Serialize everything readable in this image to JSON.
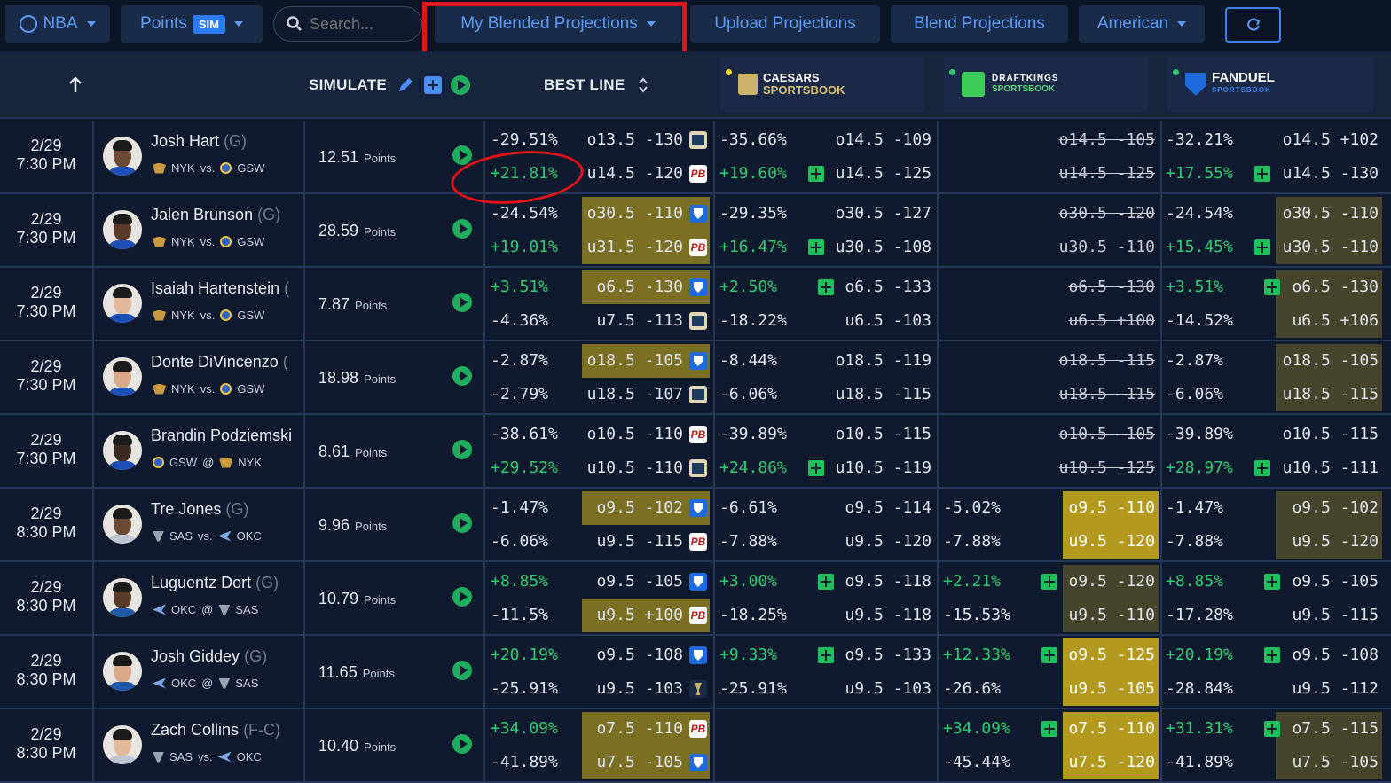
{
  "toolbar": {
    "league": "NBA",
    "market": "Points",
    "sim_badge": "SIM",
    "search_placeholder": "Search...",
    "projections": "My Blended Projections",
    "upload": "Upload Projections",
    "blend": "Blend Projections",
    "odds_format": "American"
  },
  "header": {
    "simulate": "SIMULATE",
    "best_line": "BEST LINE",
    "books": [
      {
        "name": "CAESARS",
        "sub": "SPORTSBOOK",
        "dot_color": "#f2d33a"
      },
      {
        "name": "DRAFTKINGS",
        "sub": "SPORTSBOOK",
        "dot_color": "#2ecc71"
      },
      {
        "name": "FANDUEL",
        "sub": "SPORTSBOOK",
        "dot_color": "#2ecc71"
      }
    ]
  },
  "rows": [
    {
      "date": "2/29",
      "time": "7:30 PM",
      "name": "Josh Hart",
      "pos": "(G)",
      "t1": "NYK",
      "sep": "vs.",
      "t2": "GSW",
      "sim": "12.51",
      "unit": "Points",
      "best": {
        "p1": "-29.51%",
        "l1": "o13.5 -130",
        "p2": "+21.81%",
        "l2": "u14.5 -120"
      },
      "cz": {
        "p1": "-35.66%",
        "l1": "o14.5 -109",
        "p2": "+19.60%",
        "l2": "u14.5 -125"
      },
      "dk": {
        "p1": "",
        "l1": "o14.5 -105",
        "p2": "",
        "l2": "u14.5 -125"
      },
      "fd": {
        "p1": "-32.21%",
        "l1": "o14.5 +102",
        "p2": "+17.55%",
        "l2": "u14.5 -130"
      }
    },
    {
      "date": "2/29",
      "time": "7:30 PM",
      "name": "Jalen Brunson",
      "pos": "(G)",
      "t1": "NYK",
      "sep": "vs.",
      "t2": "GSW",
      "sim": "28.59",
      "unit": "Points",
      "best": {
        "p1": "-24.54%",
        "l1": "o30.5 -110",
        "p2": "+19.01%",
        "l2": "u31.5 -120"
      },
      "cz": {
        "p1": "-29.35%",
        "l1": "o30.5 -127",
        "p2": "+16.47%",
        "l2": "u30.5 -108"
      },
      "dk": {
        "p1": "",
        "l1": "o30.5 -120",
        "p2": "",
        "l2": "u30.5 -110"
      },
      "fd": {
        "p1": "-24.54%",
        "l1": "o30.5 -110",
        "p2": "+15.45%",
        "l2": "u30.5 -110"
      }
    },
    {
      "date": "2/29",
      "time": "7:30 PM",
      "name": "Isaiah Hartenstein",
      "pos": "(",
      "t1": "NYK",
      "sep": "vs.",
      "t2": "GSW",
      "sim": "7.87",
      "unit": "Points",
      "best": {
        "p1": "+3.51%",
        "l1": "o6.5 -130",
        "p2": "-4.36%",
        "l2": "u7.5 -113"
      },
      "cz": {
        "p1": "+2.50%",
        "l1": "o6.5 -133",
        "p2": "-18.22%",
        "l2": "u6.5 -103"
      },
      "dk": {
        "p1": "",
        "l1": "o6.5 -130",
        "p2": "",
        "l2": "u6.5 +100"
      },
      "fd": {
        "p1": "+3.51%",
        "l1": "o6.5 -130",
        "p2": "-14.52%",
        "l2": "u6.5 +106"
      }
    },
    {
      "date": "2/29",
      "time": "7:30 PM",
      "name": "Donte DiVincenzo",
      "pos": "(",
      "t1": "NYK",
      "sep": "vs.",
      "t2": "GSW",
      "sim": "18.98",
      "unit": "Points",
      "best": {
        "p1": "-2.87%",
        "l1": "o18.5 -105",
        "p2": "-2.79%",
        "l2": "u18.5 -107"
      },
      "cz": {
        "p1": "-8.44%",
        "l1": "o18.5 -119",
        "p2": "-6.06%",
        "l2": "u18.5 -115"
      },
      "dk": {
        "p1": "",
        "l1": "o18.5 -115",
        "p2": "",
        "l2": "u18.5 -115"
      },
      "fd": {
        "p1": "-2.87%",
        "l1": "o18.5 -105",
        "p2": "-6.06%",
        "l2": "u18.5 -115"
      }
    },
    {
      "date": "2/29",
      "time": "7:30 PM",
      "name": "Brandin Podziemski",
      "pos": "",
      "t1": "GSW",
      "sep": "@",
      "t2": "NYK",
      "sim": "8.61",
      "unit": "Points",
      "best": {
        "p1": "-38.61%",
        "l1": "o10.5 -110",
        "p2": "+29.52%",
        "l2": "u10.5 -110"
      },
      "cz": {
        "p1": "-39.89%",
        "l1": "o10.5 -115",
        "p2": "+24.86%",
        "l2": "u10.5 -119"
      },
      "dk": {
        "p1": "",
        "l1": "o10.5 -105",
        "p2": "",
        "l2": "u10.5 -125"
      },
      "fd": {
        "p1": "-39.89%",
        "l1": "o10.5 -115",
        "p2": "+28.97%",
        "l2": "u10.5 -111"
      }
    },
    {
      "date": "2/29",
      "time": "8:30 PM",
      "name": "Tre Jones",
      "pos": "(G)",
      "t1": "SAS",
      "sep": "vs.",
      "t2": "OKC",
      "sim": "9.96",
      "unit": "Points",
      "best": {
        "p1": "-1.47%",
        "l1": "o9.5 -102",
        "p2": "-6.06%",
        "l2": "u9.5 -115"
      },
      "cz": {
        "p1": "-6.61%",
        "l1": "o9.5 -114",
        "p2": "-7.88%",
        "l2": "u9.5 -120"
      },
      "dk": {
        "p1": "-5.02%",
        "l1": "o9.5 -110",
        "p2": "-7.88%",
        "l2": "u9.5 -120"
      },
      "fd": {
        "p1": "-1.47%",
        "l1": "o9.5 -102",
        "p2": "-7.88%",
        "l2": "u9.5 -120"
      }
    },
    {
      "date": "2/29",
      "time": "8:30 PM",
      "name": "Luguentz Dort",
      "pos": "(G)",
      "t1": "OKC",
      "sep": "@",
      "t2": "SAS",
      "sim": "10.79",
      "unit": "Points",
      "best": {
        "p1": "+8.85%",
        "l1": "o9.5 -105",
        "p2": "-11.5%",
        "l2": "u9.5 +100"
      },
      "cz": {
        "p1": "+3.00%",
        "l1": "o9.5 -118",
        "p2": "-18.25%",
        "l2": "u9.5 -118"
      },
      "dk": {
        "p1": "+2.21%",
        "l1": "o9.5 -120",
        "p2": "-15.53%",
        "l2": "u9.5 -110"
      },
      "fd": {
        "p1": "+8.85%",
        "l1": "o9.5 -105",
        "p2": "-17.28%",
        "l2": "u9.5 -115"
      }
    },
    {
      "date": "2/29",
      "time": "8:30 PM",
      "name": "Josh Giddey",
      "pos": "(G)",
      "t1": "OKC",
      "sep": "@",
      "t2": "SAS",
      "sim": "11.65",
      "unit": "Points",
      "best": {
        "p1": "+20.19%",
        "l1": "o9.5 -108",
        "p2": "-25.91%",
        "l2": "u9.5 -103"
      },
      "cz": {
        "p1": "+9.33%",
        "l1": "o9.5 -133",
        "p2": "-25.91%",
        "l2": "u9.5 -103"
      },
      "dk": {
        "p1": "+12.33%",
        "l1": "o9.5 -125",
        "p2": "-26.6%",
        "l2": "u9.5 -105"
      },
      "fd": {
        "p1": "+20.19%",
        "l1": "o9.5 -108",
        "p2": "-28.84%",
        "l2": "u9.5 -112"
      }
    },
    {
      "date": "2/29",
      "time": "8:30 PM",
      "name": "Zach Collins",
      "pos": "(F-C)",
      "t1": "SAS",
      "sep": "vs.",
      "t2": "OKC",
      "sim": "10.40",
      "unit": "Points",
      "best": {
        "p1": "+34.09%",
        "l1": "o7.5 -110",
        "p2": "-41.89%",
        "l2": "u7.5 -105"
      },
      "cz": {
        "p1": "",
        "l1": "",
        "p2": "",
        "l2": ""
      },
      "dk": {
        "p1": "+34.09%",
        "l1": "o7.5 -110",
        "p2": "-45.44%",
        "l2": "u7.5 -120"
      },
      "fd": {
        "p1": "+31.31%",
        "l1": "o7.5 -115",
        "p2": "-41.89%",
        "l2": "u7.5 -105"
      }
    }
  ]
}
